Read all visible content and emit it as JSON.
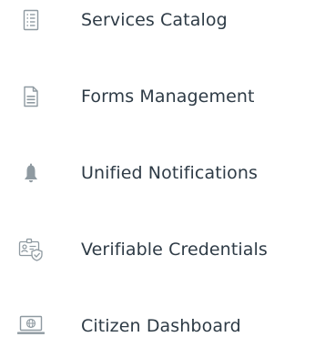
{
  "nav": {
    "items": [
      {
        "label": "Services Catalog",
        "icon": "list-document-icon"
      },
      {
        "label": "Forms Management",
        "icon": "document-icon"
      },
      {
        "label": "Unified Notifications",
        "icon": "bell-icon"
      },
      {
        "label": "Verifiable Credentials",
        "icon": "id-card-shield-icon"
      },
      {
        "label": "Citizen Dashboard",
        "icon": "laptop-globe-icon"
      }
    ]
  },
  "colors": {
    "icon": "#8f9aa1",
    "text": "#2e3b46",
    "background": "#ffffff"
  }
}
